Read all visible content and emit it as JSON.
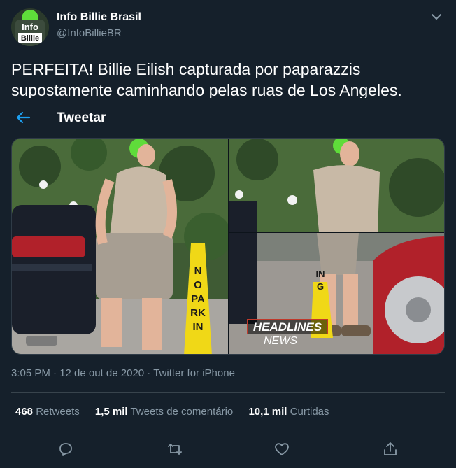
{
  "author": {
    "display_name": "Info Billie Brasil",
    "handle": "@InfoBillieBR",
    "avatar_text_1": "Info",
    "avatar_text_2": "Billie"
  },
  "tweet": {
    "text": "PERFEITA! Billie Eilish capturada por paparazzis supostamente caminhando pelas ruas de Los Angeles."
  },
  "overlay": {
    "title": "Tweetar"
  },
  "media": {
    "sign_text_left": "NO PARKIN",
    "sign_text_right": "ING",
    "watermark_line1": "HEADLINES",
    "watermark_line2": "NEWS"
  },
  "meta": {
    "line": "3:05 PM · 12 de out de 2020 · Twitter for iPhone"
  },
  "stats": {
    "retweets_count": "468",
    "retweets_label": "Retweets",
    "quote_count": "1,5 mil",
    "quote_label": "Tweets de comentário",
    "likes_count": "10,1 mil",
    "likes_label": "Curtidas"
  },
  "icons": {
    "reply": "reply-icon",
    "retweet": "retweet-icon",
    "like": "like-icon",
    "share": "share-icon",
    "back": "back-arrow-icon",
    "caret": "chevron-down-icon"
  },
  "colors": {
    "background": "#15202b",
    "accent": "#1da1f2",
    "secondary_text": "#8899a6",
    "divider": "#38444d"
  }
}
